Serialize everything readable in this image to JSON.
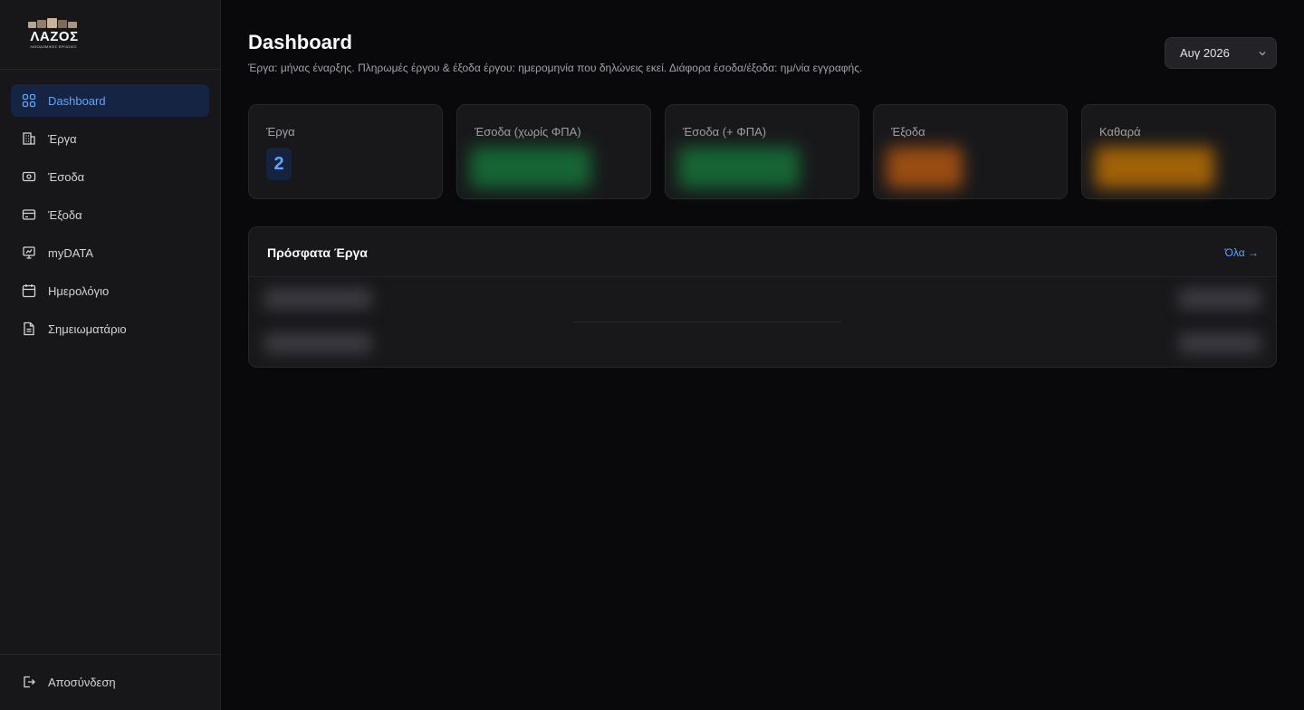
{
  "brand": {
    "name": "ΛΑΖΟΣ",
    "tagline": "ΛΙΘΟΔΟΜΙΚΕΣ ΕΡΓΑΣΙΕΣ"
  },
  "sidebar": {
    "items": [
      {
        "label": "Dashboard",
        "icon": "dashboard-grid-icon",
        "active": true
      },
      {
        "label": "Έργα",
        "icon": "building-icon",
        "active": false
      },
      {
        "label": "Έσοδα",
        "icon": "cash-icon",
        "active": false
      },
      {
        "label": "Έξοδα",
        "icon": "credit-card-icon",
        "active": false
      },
      {
        "label": "myDATA",
        "icon": "presentation-icon",
        "active": false
      },
      {
        "label": "Ημερολόγιο",
        "icon": "calendar-icon",
        "active": false
      },
      {
        "label": "Σημειωματάριο",
        "icon": "document-icon",
        "active": false
      }
    ],
    "logout_label": "Αποσύνδεση"
  },
  "header": {
    "title": "Dashboard",
    "subtitle": "Έργα: μήνας έναρξης. Πληρωμές έργου & έξοδα έργου: ημερομηνία που δηλώνεις εκεί. Διάφορα έσοδα/έξοδα: ημ/νία εγγραφής.",
    "month_select": {
      "value": "Αυγ 2026"
    }
  },
  "stats": [
    {
      "label": "Έργα",
      "value": "2"
    },
    {
      "label": "Έσοδα (χωρίς ΦΠΑ)",
      "blurred_color": "#166534"
    },
    {
      "label": "Έσοδα (+ ΦΠΑ)",
      "blurred_color": "#166534"
    },
    {
      "label": "Έξοδα",
      "blurred_color": "#9a4d12"
    },
    {
      "label": "Καθαρά",
      "blurred_color": "#a16207"
    }
  ],
  "recent": {
    "title": "Πρόσφατα Έργα",
    "all_link": "Όλα →"
  },
  "colors": {
    "accent": "#60a5fa",
    "active_bg": "#142442",
    "bg": "#09090b",
    "card": "#18181b"
  }
}
